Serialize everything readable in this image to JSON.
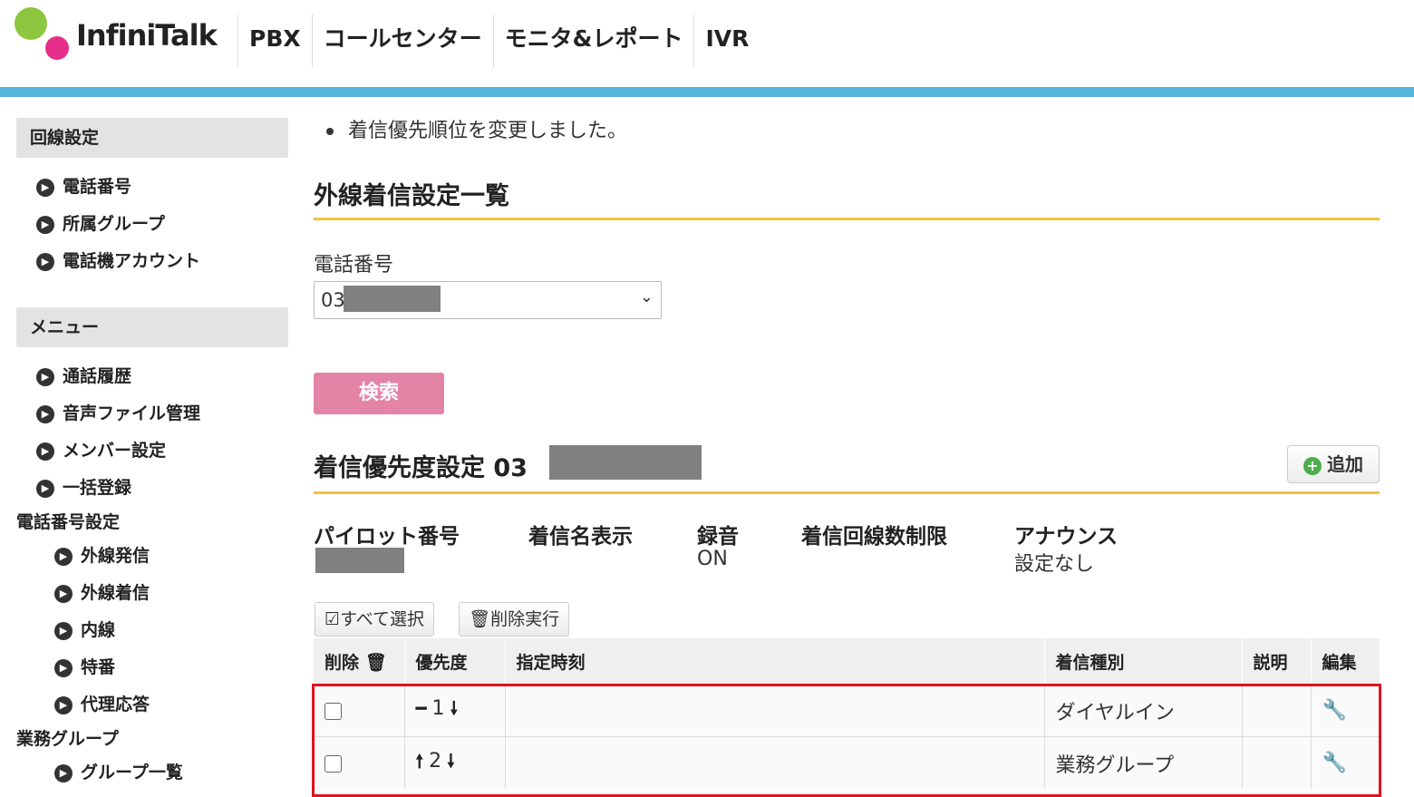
{
  "header": {
    "logo_text": "InfiniTalk",
    "nav": [
      "PBX",
      "コールセンター",
      "モニタ&レポート",
      "IVR"
    ]
  },
  "sidebar": {
    "section1_title": "回線設定",
    "section1_items": [
      "電話番号",
      "所属グループ",
      "電話機アカウント"
    ],
    "section2_title": "メニュー",
    "section2_items": [
      "通話履歴",
      "音声ファイル管理",
      "メンバー設定",
      "一括登録"
    ],
    "phone_settings_title": "電話番号設定",
    "phone_settings_items": [
      "外線発信",
      "外線着信",
      "内線",
      "特番",
      "代理応答"
    ],
    "group_title": "業務グループ",
    "group_items": [
      "グループ一覧"
    ]
  },
  "main": {
    "notice": "着信優先順位を変更しました。",
    "list_title": "外線着信設定一覧",
    "phone_label": "電話番号",
    "phone_select_value": "03",
    "search_button": "検索",
    "priority_title": "着信優先度設定 03",
    "add_button": "追加",
    "info": {
      "pilot_label": "パイロット番号",
      "caller_name_label": "着信名表示",
      "recording_label": "録音",
      "recording_value": "ON",
      "line_limit_label": "着信回線数制限",
      "announce_label": "アナウンス",
      "announce_value": "設定なし"
    },
    "select_all_button": "すべて選択",
    "delete_button": "削除実行",
    "table": {
      "headers": [
        "削除",
        "優先度",
        "指定時刻",
        "着信種別",
        "説明",
        "編集"
      ],
      "rows": [
        {
          "priority": "1",
          "time": "",
          "type": "ダイヤルイン",
          "desc": ""
        },
        {
          "priority": "2",
          "time": "",
          "type": "業務グループ",
          "desc": ""
        }
      ]
    }
  },
  "colors": {
    "accent_bar": "#55b3dc",
    "rule": "#f5c042",
    "search_button": "#e383a6",
    "highlight": "#e0141e"
  }
}
